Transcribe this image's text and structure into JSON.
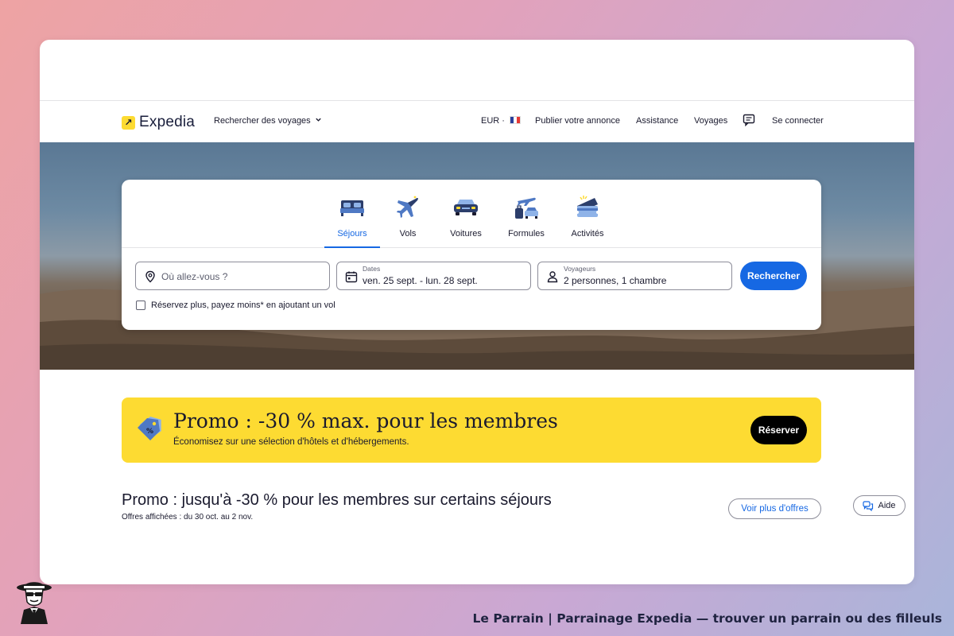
{
  "header": {
    "logo_text": "Expedia",
    "logo_mark": "↗",
    "search_trips": "Rechercher des voyages",
    "currency": "EUR ·",
    "publish": "Publier votre annonce",
    "assistance": "Assistance",
    "trips": "Voyages",
    "login": "Se connecter"
  },
  "tabs": [
    {
      "label": "Séjours",
      "icon": "bed-icon",
      "active": true
    },
    {
      "label": "Vols",
      "icon": "airplane-icon",
      "active": false
    },
    {
      "label": "Voitures",
      "icon": "car-icon",
      "active": false
    },
    {
      "label": "Formules",
      "icon": "package-icon",
      "active": false
    },
    {
      "label": "Activités",
      "icon": "ticket-icon",
      "active": false
    }
  ],
  "search": {
    "destination_placeholder": "Où allez-vous ?",
    "dates_caption": "Dates",
    "dates_value": "ven. 25 sept. - lun. 28 sept.",
    "travelers_caption": "Voyageurs",
    "travelers_value": "2 personnes, 1 chambre",
    "button": "Rechercher",
    "checkbox_label": "Réservez plus, payez moins* en ajoutant un vol"
  },
  "promo": {
    "title": "Promo : -30 % max. pour les membres",
    "subtitle": "Économisez sur une sélection d'hôtels et d'hébergements.",
    "button": "Réserver",
    "icon": "percent-tag-icon"
  },
  "offers": {
    "title": "Promo : jusqu'à -30 % pour les membres sur certains séjours",
    "subtitle": "Offres affichées : du 30 oct. au 2 nov.",
    "more_button": "Voir plus d'offres"
  },
  "help": {
    "label": "Aide"
  },
  "caption": "Le Parrain | Parrainage Expedia — trouver un parrain ou des filleuls",
  "colors": {
    "accent_blue": "#1668e3",
    "promo_yellow": "#fddb32",
    "text_dark": "#1a1a2e"
  }
}
